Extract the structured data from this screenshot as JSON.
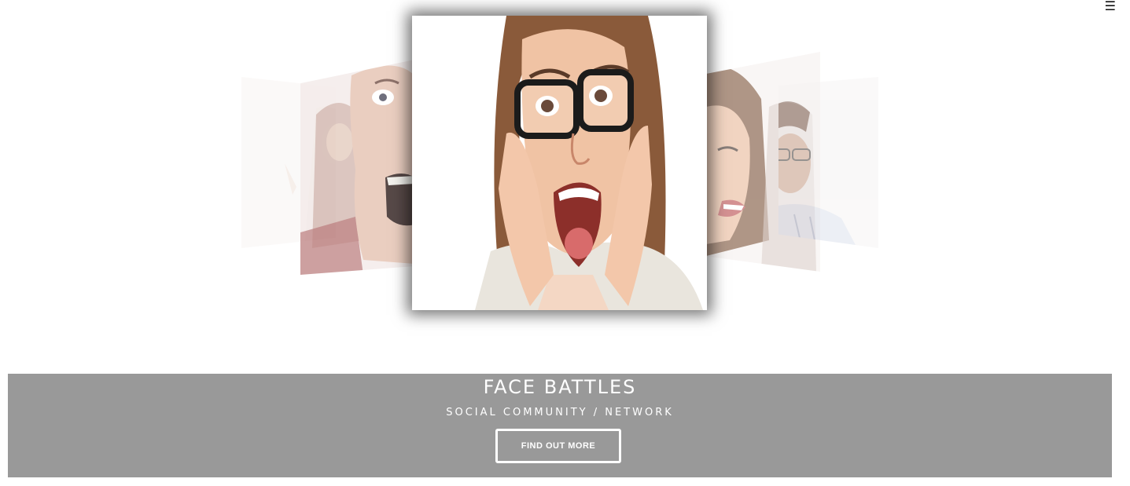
{
  "nav": {
    "menu_icon": "☰"
  },
  "carousel": {
    "slides": [
      {
        "name": "woman-surprised-faded",
        "position": "far-left"
      },
      {
        "name": "man-screaming",
        "position": "near-left"
      },
      {
        "name": "woman-glasses-screaming",
        "position": "center"
      },
      {
        "name": "woman-smiling",
        "position": "near-right"
      },
      {
        "name": "man-glasses",
        "position": "far-right"
      }
    ]
  },
  "hero": {
    "title": "FACE BATTLES",
    "subtitle": "SOCIAL COMMUNITY / NETWORK",
    "button_label": "FIND OUT MORE",
    "band_color": "#999999"
  }
}
